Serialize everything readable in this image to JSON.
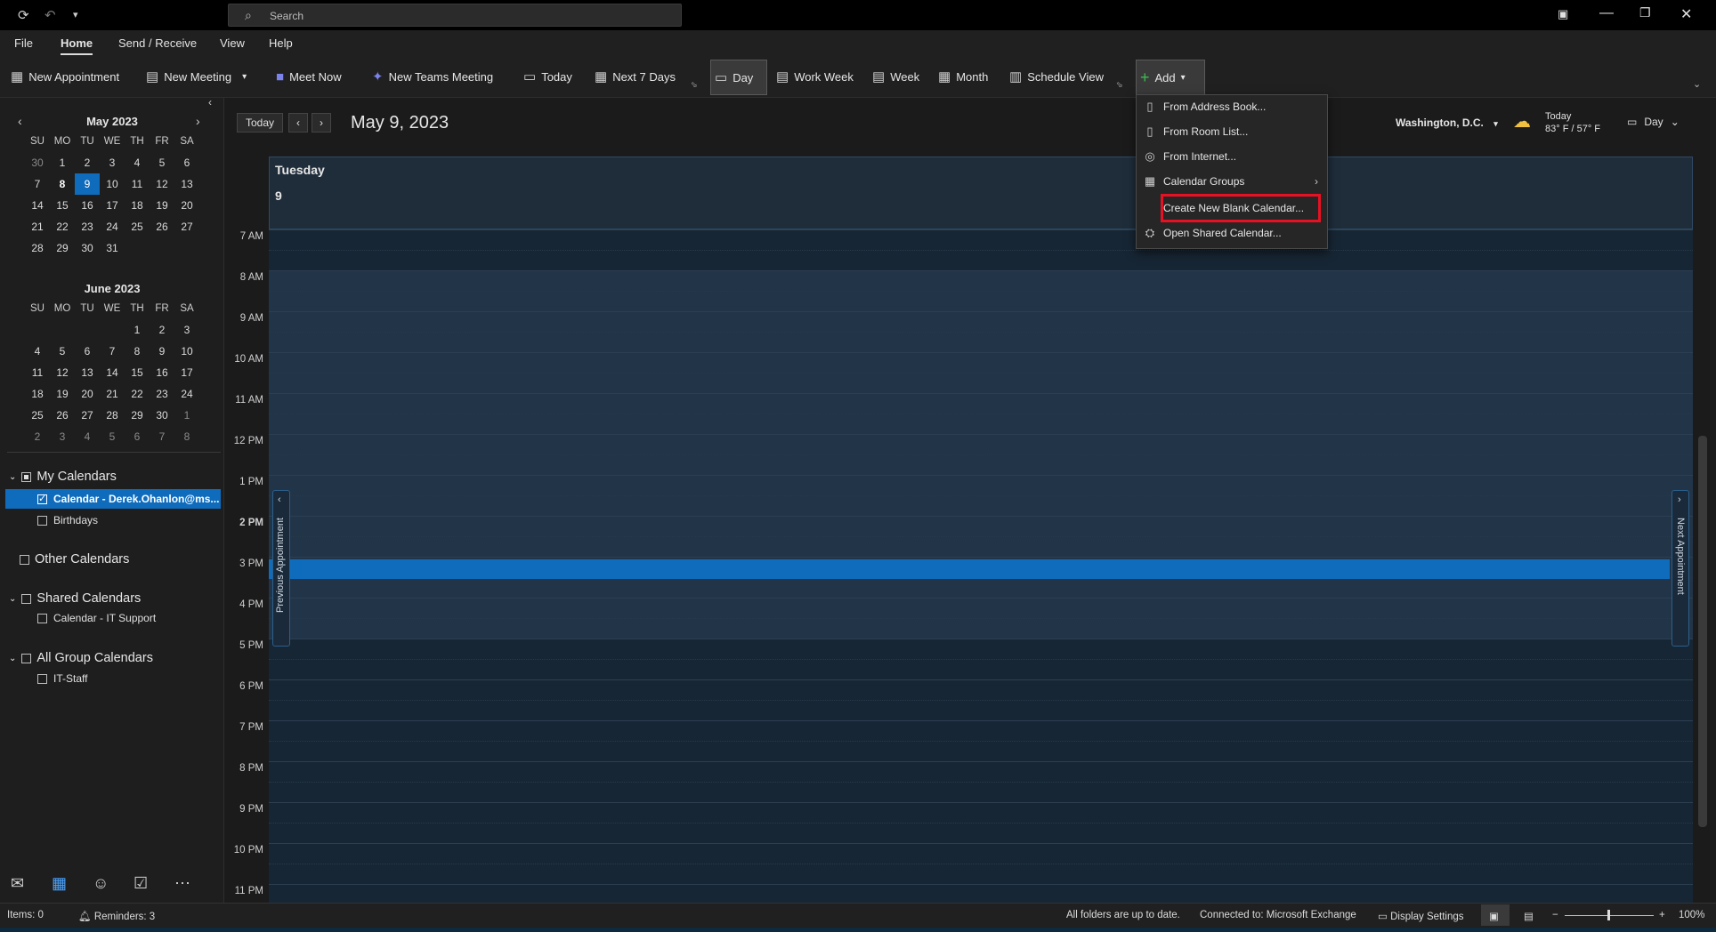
{
  "titlebar": {
    "search_placeholder": "Search"
  },
  "menus": [
    "File",
    "Home",
    "Send / Receive",
    "View",
    "Help"
  ],
  "ribbon": {
    "new_appointment": "New Appointment",
    "new_meeting": "New Meeting",
    "meet_now": "Meet Now",
    "new_teams_meeting": "New Teams Meeting",
    "today": "Today",
    "next7": "Next 7 Days",
    "day": "Day",
    "work_week": "Work Week",
    "week": "Week",
    "month": "Month",
    "schedule_view": "Schedule View",
    "add": "Add"
  },
  "dropdown": {
    "items": [
      "From Address Book...",
      "From Room List...",
      "From Internet...",
      "Calendar Groups",
      "Create New Blank Calendar...",
      "Open Shared Calendar..."
    ]
  },
  "mini_cal": {
    "may_title": "May 2023",
    "june_title": "June 2023",
    "weekdays": [
      "SU",
      "MO",
      "TU",
      "WE",
      "TH",
      "FR",
      "SA"
    ],
    "may_days": [
      "30",
      "1",
      "2",
      "3",
      "4",
      "5",
      "6",
      "7",
      "8",
      "9",
      "10",
      "11",
      "12",
      "13",
      "14",
      "15",
      "16",
      "17",
      "18",
      "19",
      "20",
      "21",
      "22",
      "23",
      "24",
      "25",
      "26",
      "27",
      "28",
      "29",
      "30",
      "31"
    ],
    "june_days": [
      "1",
      "2",
      "3",
      "4",
      "5",
      "6",
      "7",
      "8",
      "9",
      "10",
      "11",
      "12",
      "13",
      "14",
      "15",
      "16",
      "17",
      "18",
      "19",
      "20",
      "21",
      "22",
      "23",
      "24",
      "25",
      "26",
      "27",
      "28",
      "29",
      "30",
      "1",
      "2",
      "3",
      "4",
      "5",
      "6",
      "7",
      "8"
    ]
  },
  "folders": {
    "my_calendars": "My Calendars",
    "calendar_derek": "Calendar - Derek.Ohanlon@ms...",
    "birthdays": "Birthdays",
    "other_calendars": "Other Calendars",
    "shared_calendars": "Shared Calendars",
    "calendar_it": "Calendar - IT Support",
    "all_group": "All Group Calendars",
    "it_staff": "IT-Staff"
  },
  "main": {
    "today_btn": "Today",
    "date": "May 9, 2023",
    "location": "Washington, D.C.",
    "weather_title": "Today",
    "weather_temp": "83° F / 57° F",
    "view_select": "Day",
    "day_name": "Tuesday",
    "day_num": "9",
    "prev_appt": "Previous Appointment",
    "next_appt": "Next Appointment",
    "hours": [
      "7 AM",
      "8 AM",
      "9 AM",
      "10 AM",
      "11 AM",
      "12 PM",
      "1 PM",
      "2 PM",
      "3 PM",
      "4 PM",
      "5 PM",
      "6 PM",
      "7 PM",
      "8 PM",
      "9 PM",
      "10 PM",
      "11 PM"
    ]
  },
  "status": {
    "items": "Items: 0",
    "reminders": "Reminders: 3",
    "sync": "All folders are up to date.",
    "connected": "Connected to: Microsoft Exchange",
    "display": "Display Settings",
    "zoom": "100%"
  }
}
